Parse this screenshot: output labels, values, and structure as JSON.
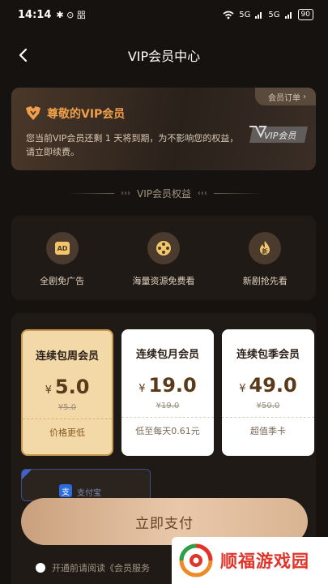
{
  "status_bar": {
    "time": "14:14",
    "left_icons": "✱ ⊙ 㗊",
    "signal_1": "5G",
    "signal_2": "5G",
    "battery": "90"
  },
  "header": {
    "title": "VIP会员中心"
  },
  "vip_card": {
    "title": "尊敬的VIP会员",
    "orders_link": "会员订单",
    "description": "您当前VIP会员还剩 1 天将到期，为不影响您的权益，请立即续费。",
    "logo_text": "VIP会员",
    "accent_color": "#f0a04a"
  },
  "benefits": {
    "header": "VIP会员权益",
    "items": [
      {
        "label": "全剧免广告",
        "icon": "ad-icon"
      },
      {
        "label": "海量资源免费看",
        "icon": "film-reel-icon"
      },
      {
        "label": "新剧抢先看",
        "icon": "flame-icon"
      }
    ]
  },
  "plans": [
    {
      "name": "连续包周会员",
      "currency": "¥",
      "price": "5.0",
      "original": "¥5.0",
      "tagline": "价格更低",
      "selected": true
    },
    {
      "name": "连续包月会员",
      "currency": "¥",
      "price": "19.0",
      "original": "¥19.0",
      "tagline": "低至每天0.61元",
      "selected": false
    },
    {
      "name": "连续包季会员",
      "currency": "¥",
      "price": "49.0",
      "original": "¥50.0",
      "tagline": "超值季卡",
      "selected": false
    }
  ],
  "payment": {
    "method_label": "支付宝"
  },
  "pay_button": {
    "label": "立即支付"
  },
  "agreement": {
    "text": "开通前请阅读《会员服务"
  },
  "watermark": {
    "text": "顺福游戏园"
  }
}
